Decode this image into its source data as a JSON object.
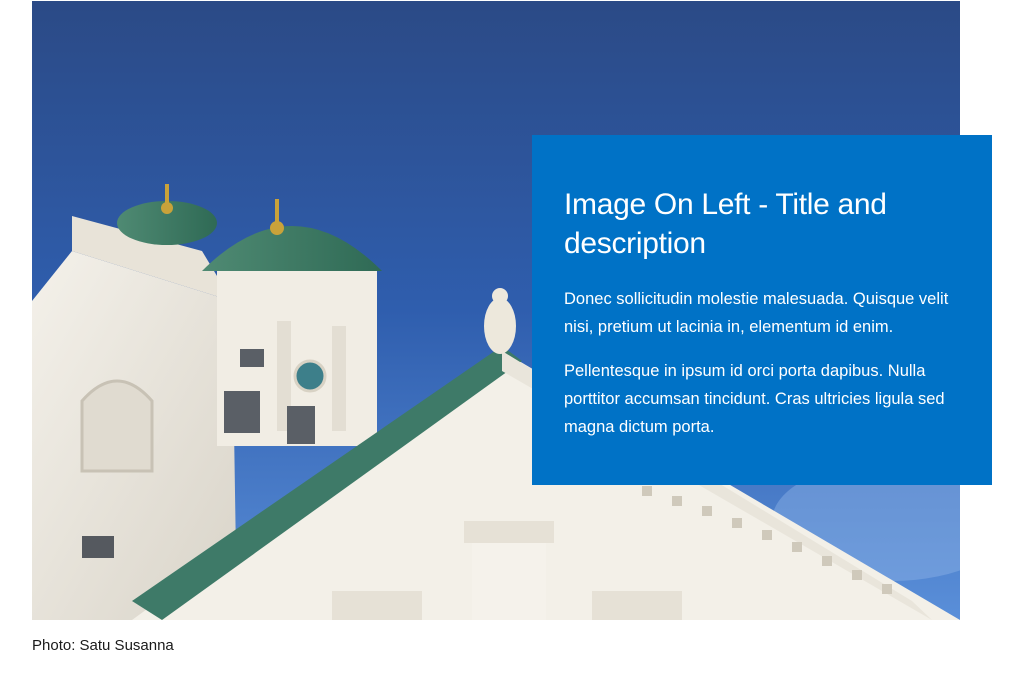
{
  "hero": {
    "image_alt": "Helsinki Cathedral against a blue sky",
    "caption": "Photo: Satu Susanna"
  },
  "card": {
    "title": "Image On Left - Title and description",
    "paragraphs": [
      "Donec sollicitudin molestie malesuada. Quisque velit nisi, pretium ut lacinia in, elementum id enim.",
      "Pellentesque in ipsum id orci porta dapibus. Nulla porttitor accumsan tincidunt. Cras ultricies ligula sed magna dictum porta."
    ],
    "background_color": "#0072c6"
  }
}
